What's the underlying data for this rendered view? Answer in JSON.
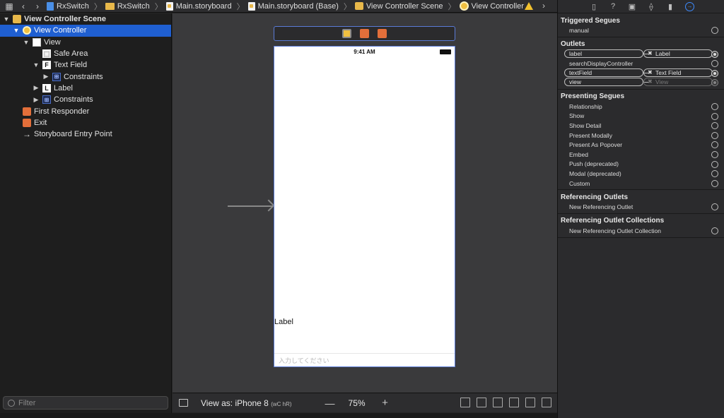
{
  "jumpbar": {
    "crumbs": [
      {
        "label": "RxSwitch",
        "icon": "swift-project-icon"
      },
      {
        "label": "RxSwitch",
        "icon": "folder-icon"
      },
      {
        "label": "Main.storyboard",
        "icon": "storyboard-icon"
      },
      {
        "label": "Main.storyboard (Base)",
        "icon": "storyboard-icon"
      },
      {
        "label": "View Controller Scene",
        "icon": "scene-icon"
      },
      {
        "label": "View Controller",
        "icon": "view-controller-icon"
      }
    ]
  },
  "outline": {
    "items": [
      {
        "label": "View Controller Scene"
      },
      {
        "label": "View Controller"
      },
      {
        "label": "View"
      },
      {
        "label": "Safe Area"
      },
      {
        "label": "Text Field"
      },
      {
        "label": "Constraints"
      },
      {
        "label": "Label"
      },
      {
        "label": "Constraints"
      },
      {
        "label": "First Responder"
      },
      {
        "label": "Exit"
      },
      {
        "label": "Storyboard Entry Point"
      }
    ],
    "filter_placeholder": "Filter"
  },
  "canvas": {
    "status_time": "9:41 AM",
    "label_text": "Label",
    "textfield_placeholder": "入力してください",
    "view_as": "View as: iPhone 8",
    "size_class": "(wC hR)",
    "zoom": "75%"
  },
  "inspector": {
    "sections": {
      "triggered": "Triggered Segues",
      "outlets": "Outlets",
      "presenting": "Presenting Segues",
      "referencing": "Referencing Outlets",
      "collections": "Referencing Outlet Collections"
    },
    "triggered_items": [
      "manual"
    ],
    "outlets": [
      {
        "name": "label",
        "target": "Label"
      },
      {
        "name": "searchDisplayController",
        "target": ""
      },
      {
        "name": "textField",
        "target": "Text Field"
      },
      {
        "name": "view",
        "target": "View"
      }
    ],
    "presenting_items": [
      "Relationship",
      "Show",
      "Show Detail",
      "Present Modally",
      "Present As Popover",
      "Embed",
      "Push (deprecated)",
      "Modal (deprecated)",
      "Custom"
    ],
    "referencing_item": "New Referencing Outlet",
    "collection_item": "New Referencing Outlet Collection"
  }
}
